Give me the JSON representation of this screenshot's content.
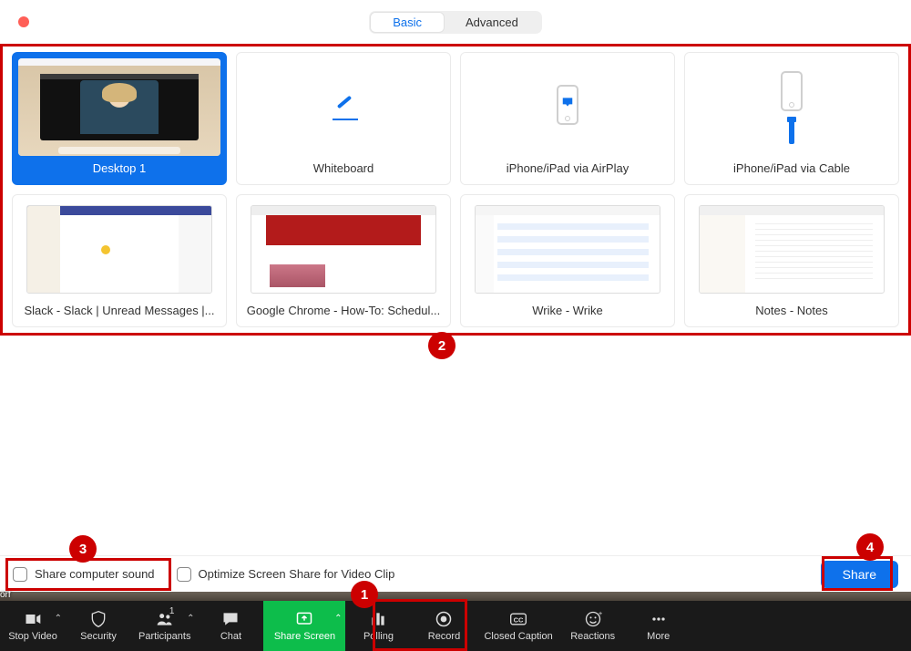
{
  "tabs": {
    "basic": "Basic",
    "advanced": "Advanced"
  },
  "options": [
    {
      "id": "desktop1",
      "label": "Desktop 1",
      "selected": true
    },
    {
      "id": "whiteboard",
      "label": "Whiteboard"
    },
    {
      "id": "airplay",
      "label": "iPhone/iPad via AirPlay"
    },
    {
      "id": "cable",
      "label": "iPhone/iPad via Cable"
    },
    {
      "id": "slack",
      "label": "Slack - Slack | Unread Messages |..."
    },
    {
      "id": "chrome",
      "label": "Google Chrome - How-To: Schedul..."
    },
    {
      "id": "wrike",
      "label": "Wrike - Wrike"
    },
    {
      "id": "notes",
      "label": "Notes - Notes"
    }
  ],
  "checkboxes": {
    "sound": "Share computer sound",
    "optimize": "Optimize Screen Share for Video Clip"
  },
  "share_button": "Share",
  "toolbar": {
    "stop_video": "Stop Video",
    "security": "Security",
    "participants": "Participants",
    "participants_count": "1",
    "chat": "Chat",
    "share_screen": "Share Screen",
    "polling": "Polling",
    "record": "Record",
    "closed_caption": "Closed Caption",
    "reactions": "Reactions",
    "more": "More"
  },
  "participant_fragment": "orf",
  "annotations": {
    "a1": "1",
    "a2": "2",
    "a3": "3",
    "a4": "4"
  }
}
